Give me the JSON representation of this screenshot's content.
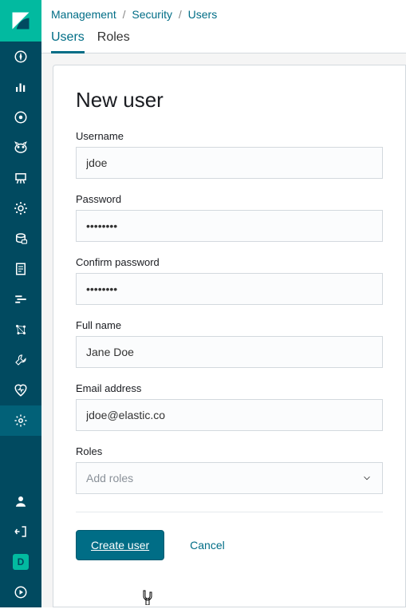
{
  "breadcrumb": {
    "root": "Management",
    "mid": "Security",
    "leaf": "Users"
  },
  "tabs": {
    "users": "Users",
    "roles": "Roles"
  },
  "page": {
    "title": "New user"
  },
  "form": {
    "username": {
      "label": "Username",
      "value": "jdoe"
    },
    "password": {
      "label": "Password",
      "value": "••••••••"
    },
    "confirm": {
      "label": "Confirm password",
      "value": "••••••••"
    },
    "fullname": {
      "label": "Full name",
      "value": "Jane Doe"
    },
    "email": {
      "label": "Email address",
      "value": "jdoe@elastic.co"
    },
    "roles": {
      "label": "Roles",
      "placeholder": "Add roles"
    }
  },
  "actions": {
    "create": "Create user",
    "cancel": "Cancel"
  },
  "badge": "D"
}
